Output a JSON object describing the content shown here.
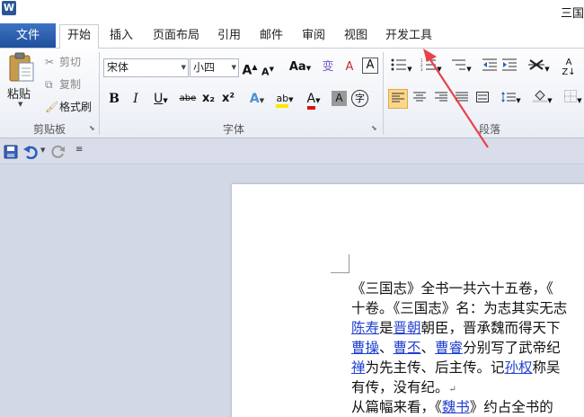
{
  "window": {
    "title": "三国"
  },
  "tabs": {
    "file": "文件",
    "items": [
      "开始",
      "插入",
      "页面布局",
      "引用",
      "邮件",
      "审阅",
      "视图",
      "开发工具"
    ]
  },
  "clipboard": {
    "paste": "粘贴",
    "cut": "剪切",
    "copy": "复制",
    "format_painter": "格式刷",
    "group_label": "剪贴板"
  },
  "font": {
    "name": "宋体",
    "size": "小四",
    "group_label": "字体",
    "grow": "A",
    "shrink": "A",
    "change_case": "Aa",
    "clear": "A",
    "phonetic": "变",
    "border": "A",
    "bold": "B",
    "italic": "I",
    "underline": "U",
    "strike": "abe",
    "subscript": "x₂",
    "superscript": "x²",
    "text_effect": "A",
    "highlight": "ab",
    "font_color": "A",
    "char_shade": "A",
    "enclose": "字"
  },
  "paragraph": {
    "group_label": "段落"
  },
  "document": {
    "lines": [
      [
        "《三国志》全书一共六十五卷，《"
      ],
      [
        "十卷。《三国志》名：为志其实无志"
      ],
      [
        "陈寿",
        "是",
        "晋朝",
        "朝臣，晋承魏而得天下"
      ],
      [
        "曹操",
        "、",
        "曹丕",
        "、",
        "曹睿",
        "分别写了武帝纪"
      ],
      [
        "禅",
        "为先主传、后主传。记",
        "孙权",
        "称吴"
      ],
      [
        "有传，没有纪。"
      ],
      [
        "从篇幅来看，《",
        "魏书",
        "》约占全书的"
      ]
    ]
  },
  "colors": {
    "file_tab": "#2b5797",
    "link": "#1f3fd0",
    "annotation_arrow": "#e8434a"
  }
}
